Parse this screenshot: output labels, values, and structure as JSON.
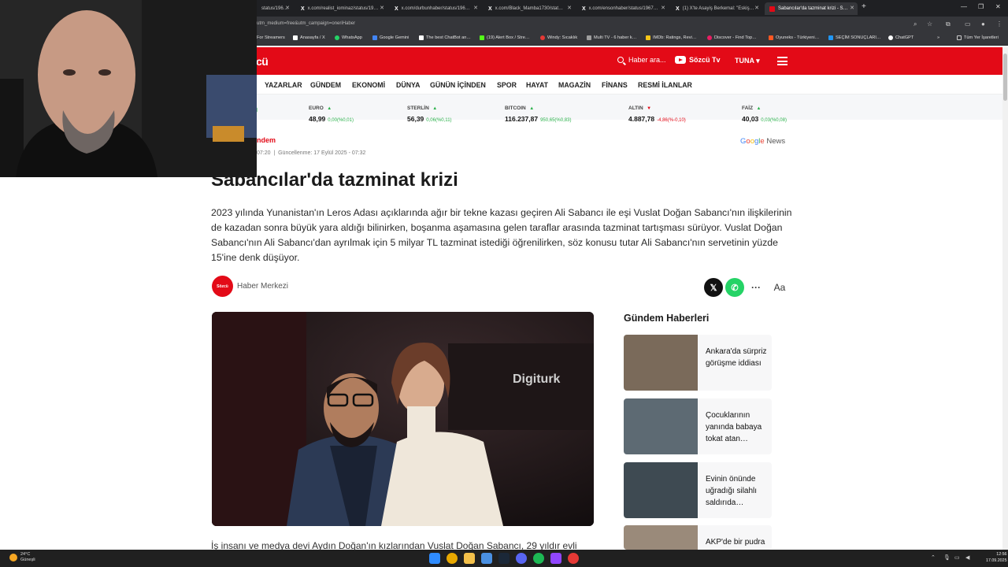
{
  "browser": {
    "tabs": [
      {
        "prefix": "",
        "title": "status/196…"
      },
      {
        "prefix": "X",
        "title": "x.com/realist_iominaz/status/19…"
      },
      {
        "prefix": "X",
        "title": "x.com/durbunhaber/status/196…"
      },
      {
        "prefix": "X",
        "title": "x.com/Black_Mamba1730/stat…"
      },
      {
        "prefix": "X",
        "title": "x.com/ensonhaber/status/1967…"
      },
      {
        "prefix": "X",
        "title": "(1) X'te Asayiş Berkemal: \"Eskiş…"
      },
      {
        "prefix": "",
        "title": "Sabancılar'da tazminat krizi - S…"
      }
    ],
    "new_tab": "+",
    "url": "utm_medium=free&utm_campaign=oneriHaber",
    "bookmarks": [
      {
        "label": "For Streamers",
        "color": "#7c4dff"
      },
      {
        "label": "Anasayfa / X",
        "color": "#ffffff"
      },
      {
        "label": "WhatsApp",
        "color": "#25d366"
      },
      {
        "label": "Google Gemini",
        "color": "#4285f4"
      },
      {
        "label": "The best ChatBot an…",
        "color": "#ffffff"
      },
      {
        "label": "(19) Alert Box / Stre…",
        "color": "#53fc18"
      },
      {
        "label": "Windy: Sıcaklık",
        "color": "#e53935"
      },
      {
        "label": "Multi TV - 6 haber k…",
        "color": "#9e9e9e"
      },
      {
        "label": "IMDb: Ratings, Revi…",
        "color": "#f5c518"
      },
      {
        "label": "Discover - Find Top…",
        "color": "#e91e63"
      },
      {
        "label": "Oyuneks - Türkiyeni…",
        "color": "#ff5722"
      },
      {
        "label": "SEÇİM SONUÇLARI…",
        "color": "#2196f3"
      },
      {
        "label": "ChatGPT",
        "color": "#ffffff"
      }
    ],
    "all_bookmarks": "Tüm Yer İşaretleri"
  },
  "site": {
    "logo": "cü",
    "search_placeholder": "Haber ara...",
    "tv_label": "Sözcü Tv",
    "user_label": "TUNA ▾",
    "nav": [
      "YAZARLAR",
      "GÜNDEM",
      "EKONOMİ",
      "DÜNYA",
      "GÜNÜN İÇİNDEN",
      "SPOR",
      "HAYAT",
      "MAGAZİN",
      "FİNANS",
      "RESMİ İLANLAR"
    ],
    "ticker": [
      {
        "name": "EURO",
        "dir": "up",
        "value": "48,99",
        "change": "0,00(%0,01)"
      },
      {
        "name": "STERLİN",
        "dir": "up",
        "value": "56,39",
        "change": "0,06(%0,11)"
      },
      {
        "name": "BITCOIN",
        "dir": "up",
        "value": "116.237,87",
        "change": "950,65(%0,83)"
      },
      {
        "name": "ALTIN",
        "dir": "down",
        "value": "4.887,78",
        "change": "-4,86(%-0,10)"
      },
      {
        "name": "FAİZ",
        "dir": "up",
        "value": "40,03",
        "change": "0,03(%0,08)"
      }
    ],
    "ticker_partial": "0)"
  },
  "article": {
    "category": "ndem",
    "dates": "07:20  |  Güncellenme: 17 Eylül 2025 - 07:32",
    "google_news": [
      "G",
      "o",
      "o",
      "g",
      "l",
      "e",
      " News"
    ],
    "title": "Sabancılar'da tazminat krizi",
    "summary": "2023 yılında Yunanistan'ın Leros Adası açıklarında ağır bir tekne kazası geçiren Ali Sabancı ile eşi Vuslat Doğan Sabancı'nın ilişkilerinin de kazadan sonra büyük yara aldığı bilinirken, boşanma aşamasına gelen taraflar arasında tazminat tartışması sürüyor. Vuslat Doğan Sabancı'nın Ali Sabancı'dan ayrılmak için 5 milyar TL tazminat istediği öğrenilirken, söz konusu tutar Ali Sabancı'nın servetinin yüzde 15'ine denk düşüyor.",
    "author_badge": "Sözcü",
    "author": "Haber Merkezi",
    "share": {
      "x": "𝕏",
      "whatsapp": "✆",
      "more": "···",
      "font": "Aa"
    },
    "image_caption_brand": "Digiturk",
    "body_start": "İş insanı ve medya devi Aydın Doğan'ın kızlarından Vuslat Doğan Sabancı, 29 yıldır evli"
  },
  "sidebar": {
    "heading": "Gündem Haberleri",
    "cards": [
      {
        "title": "Ankara'da sürpriz görüşme iddiası",
        "thumb_color": "#7a6a5a"
      },
      {
        "title": "Çocuklarının yanında babaya tokat atan…",
        "thumb_color": "#5d6a73"
      },
      {
        "title": "Evinin önünde uğradığı silahlı saldırıda…",
        "thumb_color": "#3e4a52"
      },
      {
        "title": "AKP'de bir pudra",
        "thumb_color": "#9a8a7a"
      }
    ]
  },
  "taskbar": {
    "weather_temp": "24°C",
    "weather_desc": "Güneşli",
    "time": "12:56",
    "date": "17.09.2025"
  }
}
